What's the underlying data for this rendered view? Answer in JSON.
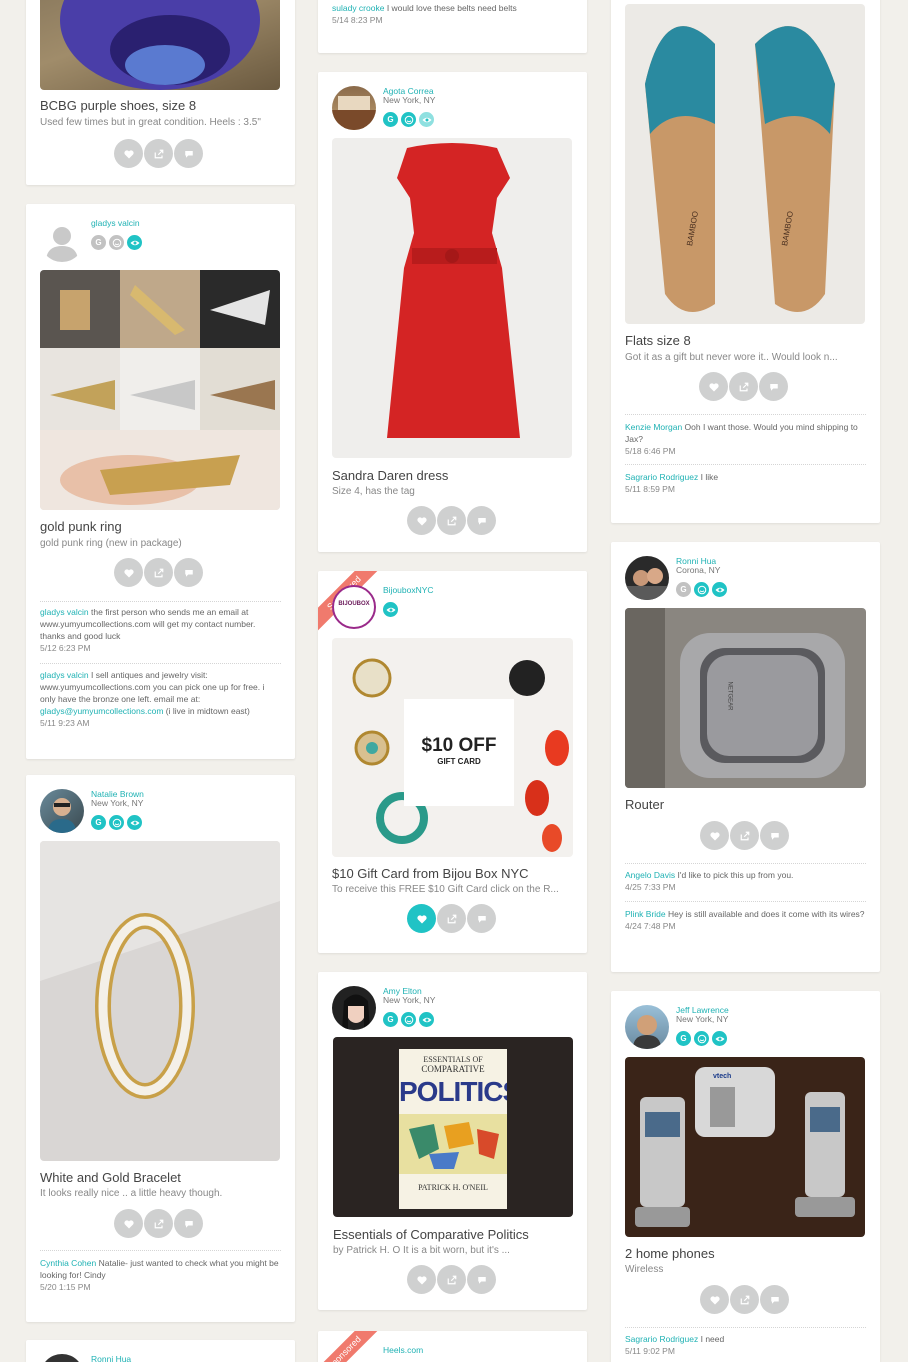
{
  "cards": {
    "bcbg": {
      "title": "BCBG purple shoes, size 8",
      "desc": "Used few times but in great condition. Heels : 3.5\""
    },
    "gladys": {
      "user": {
        "name": "gladys valcin"
      },
      "title": "gold punk ring",
      "desc": "gold punk ring (new in package)",
      "comments": [
        {
          "name": "gladys valcin",
          "text": " the first person who sends me an email at www.yumyumcollections.com will get my contact number. thanks and good luck",
          "time": "5/12 6:23 PM"
        },
        {
          "name": "gladys valcin",
          "text": " I sell antiques and jewelry visit: www.yumyumcollections.com you can pick one up for free. i only have the bronze one left. email me at: ",
          "link": "gladys@yumyumcollections.com",
          "after": " (i live in midtown east)",
          "time": "5/11 9:23 AM"
        }
      ]
    },
    "natalie": {
      "user": {
        "name": "Natalie Brown",
        "location": "New York, NY"
      },
      "title": "White and Gold Bracelet",
      "desc": "It looks really nice .. a little heavy though.",
      "comments": [
        {
          "name": "Cynthia Cohen",
          "text": " Natalie- just wanted to check what you might be looking for! Cindy",
          "time": "5/20 1:15 PM"
        }
      ]
    },
    "ronni_bottom": {
      "user": {
        "name": "Ronni Hua"
      }
    },
    "sulady": {
      "comment": {
        "name": "sulady crooke",
        "text": " I would love these belts need belts",
        "time": "5/14 8:23 PM"
      }
    },
    "agota": {
      "user": {
        "name": "Agota Correa",
        "location": "New York, NY"
      },
      "title": "Sandra Daren dress",
      "desc": "Size 4, has the tag"
    },
    "bijoubox": {
      "ribbon": "Sponsored",
      "user": {
        "name": "BijouboxNYC",
        "logo": "BIJOUBOX"
      },
      "gift_big": "$10 OFF",
      "gift_small": "GIFT CARD",
      "title": "$10 Gift Card from Bijou Box NYC",
      "desc": "To receive this FREE $10 Gift Card click on the R..."
    },
    "amy": {
      "user": {
        "name": "Amy Elton",
        "location": "New York, NY"
      },
      "book_top": "ESSENTIALS OF",
      "book_mid": "COMPARATIVE",
      "book_big": "POLITICS",
      "book_author": "PATRICK H. O'NEIL",
      "title": "Essentials of Comparative Politics",
      "desc": "by Patrick H. O It is a bit worn, but it's ..."
    },
    "heels": {
      "ribbon": "Sponsored",
      "user": {
        "name": "Heels.com"
      }
    },
    "flats": {
      "title": "Flats size 8",
      "desc": "Got it as a gift but never wore it.. Would look n...",
      "brand": "BAMBOO",
      "comments": [
        {
          "name": "Kenzie Morgan",
          "text": " Ooh I want those. Would you mind shipping to Jax?",
          "time": "5/18 6:46 PM"
        },
        {
          "name": "Sagrario Rodriguez",
          "text": " I like",
          "time": "5/11 8:59 PM"
        }
      ]
    },
    "ronni": {
      "user": {
        "name": "Ronni Hua",
        "location": "Corona, NY"
      },
      "router_brand": "NETGEAR",
      "title": "Router",
      "comments": [
        {
          "name": "Angelo Davis",
          "text": " I'd like to pick this up from you.",
          "time": "4/25 7:33 PM"
        },
        {
          "name": "Plink Bride",
          "text": " Hey is still available and does it come with its wires?",
          "time": "4/24 7:48 PM"
        }
      ]
    },
    "jeff": {
      "user": {
        "name": "Jeff Lawrence",
        "location": "New York, NY"
      },
      "phone_brand": "vtech",
      "title": "2 home phones",
      "desc": "Wireless",
      "comments": [
        {
          "name": "Sagrario Rodriguez",
          "text": " I need",
          "time": "5/11 9:02 PM"
        }
      ]
    }
  },
  "badge_letter": "G",
  "icons": [
    "heart-icon",
    "share-icon",
    "comment-icon",
    "smile-icon",
    "eye-icon",
    "person-icon"
  ],
  "colors": {
    "accent": "#20c3c5",
    "ribbon": "#f07a6d",
    "background": "#f2f0eb"
  }
}
